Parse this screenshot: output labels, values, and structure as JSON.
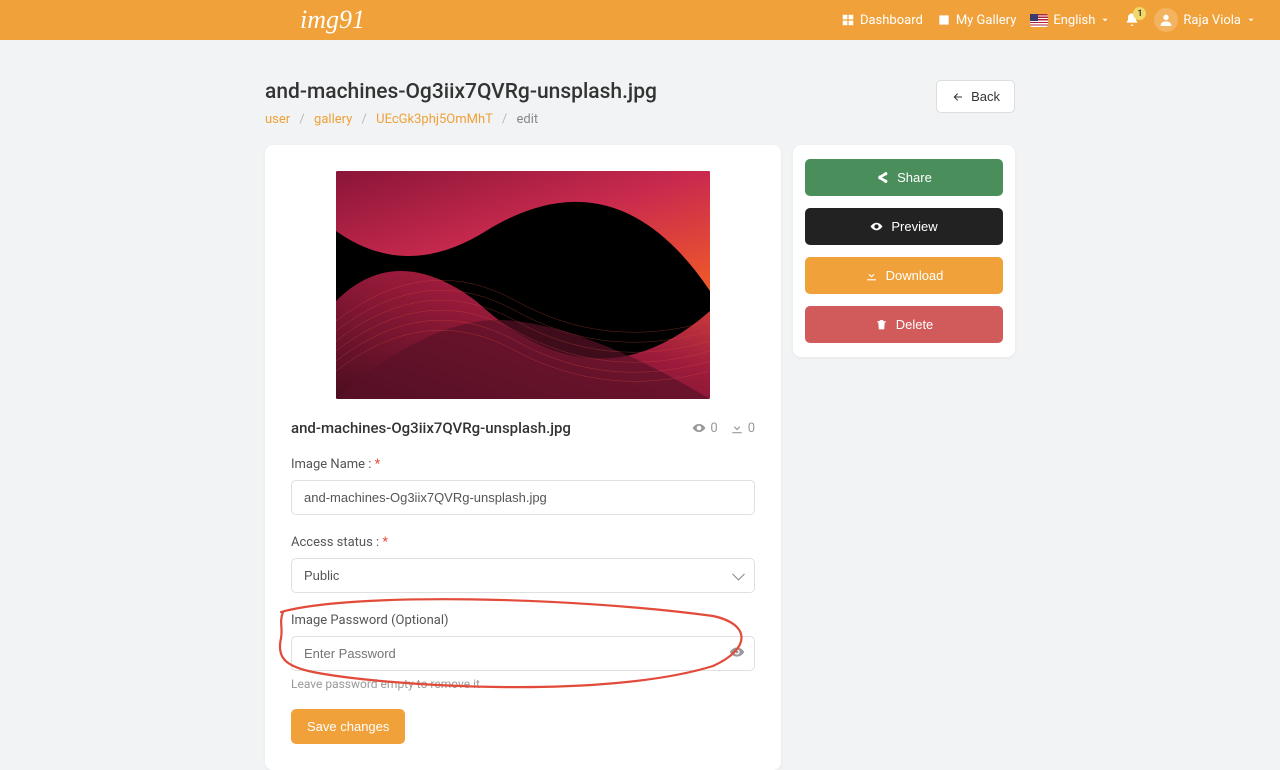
{
  "brand": "img91",
  "nav": {
    "dashboard": "Dashboard",
    "gallery": "My Gallery",
    "language": "English",
    "user": "Raja Viola",
    "notifications": "1"
  },
  "page": {
    "title": "and-machines-Og3iix7QVRg-unsplash.jpg",
    "back": "Back"
  },
  "breadcrumb": {
    "user": "user",
    "gallery": "gallery",
    "id": "UEcGk3phj5OmMhT",
    "edit": "edit"
  },
  "image": {
    "title": "and-machines-Og3iix7QVRg-unsplash.jpg",
    "views": "0",
    "downloads": "0"
  },
  "form": {
    "name_label": "Image Name :",
    "name_value": "and-machines-Og3iix7QVRg-unsplash.jpg",
    "access_label": "Access status :",
    "access_value": "Public",
    "password_label": "Image Password (Optional)",
    "password_placeholder": "Enter Password",
    "password_hint": "Leave password empty to remove it",
    "save": "Save changes"
  },
  "actions": {
    "share": "Share",
    "preview": "Preview",
    "download": "Download",
    "delete": "Delete"
  }
}
